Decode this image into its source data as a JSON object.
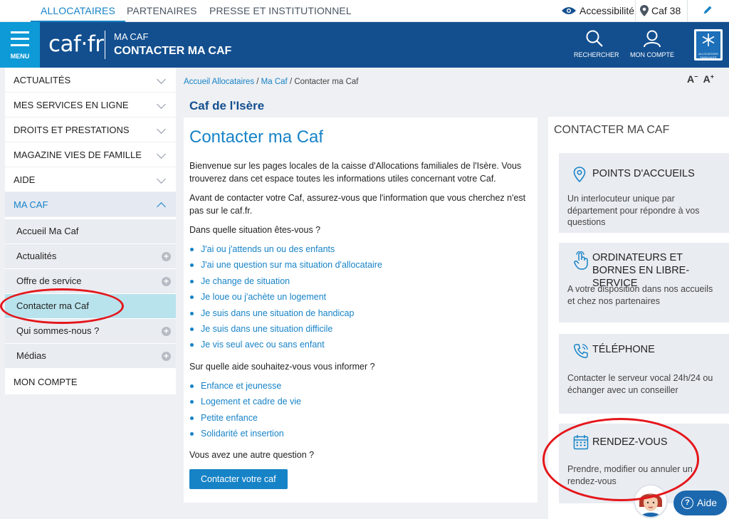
{
  "top_nav": {
    "tabs": [
      "ALLOCATAIRES",
      "PARTENAIRES",
      "PRESSE ET INSTITUTIONNEL"
    ],
    "accessibility": "Accessibilité",
    "location": "Caf 38"
  },
  "header": {
    "menu_label": "MENU",
    "logo": "caf·fr",
    "section": "MA CAF",
    "title": "CONTACTER MA CAF",
    "search_label": "RECHERCHER",
    "account_label": "MON COMPTE",
    "emblem_text": "ALLOCATIONS FAMILIALES"
  },
  "sidebar": {
    "items": [
      {
        "label": "ACTUALITÉS"
      },
      {
        "label": "MES SERVICES EN LIGNE"
      },
      {
        "label": "DROITS ET PRESTATIONS"
      },
      {
        "label": "MAGAZINE VIES DE FAMILLE"
      },
      {
        "label": "AIDE"
      },
      {
        "label": "MA CAF"
      }
    ],
    "sub_items": [
      {
        "label": "Accueil Ma Caf"
      },
      {
        "label": "Actualités"
      },
      {
        "label": "Offre de service"
      },
      {
        "label": "Contacter ma Caf"
      },
      {
        "label": "Qui sommes-nous ?"
      },
      {
        "label": "Médias"
      }
    ],
    "account": "MON COMPTE"
  },
  "breadcrumb": {
    "home": "Accueil Allocataires",
    "parent": "Ma Caf",
    "current": "Contacter ma Caf",
    "sep": " / "
  },
  "text_size": {
    "decrease": "A",
    "increase": "A"
  },
  "caf_name": "Caf de l'Isère",
  "main": {
    "title": "Contacter ma Caf",
    "intro": "Bienvenue sur les pages locales de la caisse d'Allocations familiales de l'Isère. Vous trouverez dans cet espace toutes les informations utiles concernant votre Caf.",
    "advice": "Avant de contacter votre Caf, assurez-vous que l'information que vous cherchez n'est pas sur le caf.fr.",
    "situation_q": "Dans quelle situation êtes-vous ?",
    "situations": [
      "J'ai ou j'attends un ou des enfants",
      "J'ai une question sur ma situation d'allocataire",
      "Je change de situation",
      "Je loue ou j'achète un logement",
      "Je suis dans une situation de handicap",
      "Je suis dans une situation difficile",
      "Je vis seul avec ou sans enfant"
    ],
    "aide_q": "Sur quelle aide souhaitez-vous vous informer ?",
    "aides": [
      "Enfance et jeunesse",
      "Logement et cadre de vie",
      "Petite enfance",
      "Solidarité et insertion"
    ],
    "other_q": "Vous avez une autre question ?",
    "button": "Contacter votre caf"
  },
  "right": {
    "title": "CONTACTER MA CAF",
    "cards": [
      {
        "title": "POINTS D'ACCUEILS",
        "text": "Un interlocuteur unique par département pour répondre à vos questions",
        "icon": "location-pin-icon"
      },
      {
        "title": "ORDINATEURS ET BORNES EN LIBRE-SERVICE",
        "text": "A votre disposition dans nos accueils et chez nos partenaires",
        "icon": "touch-hand-icon"
      },
      {
        "title": "TÉLÉPHONE",
        "text": "Contacter le serveur vocal 24h/24 ou échanger avec un conseiller",
        "icon": "phone-icon"
      },
      {
        "title": "RENDEZ-VOUS",
        "text": "Prendre, modifier ou annuler un rendez-vous",
        "icon": "calendar-icon"
      }
    ]
  },
  "help": {
    "label": "Aide",
    "q": "?"
  },
  "colors": {
    "brand_blue": "#134f8f",
    "link_blue": "#1783c7",
    "menu_cyan": "#0d9ad7",
    "annotation_red": "#e4161b"
  }
}
